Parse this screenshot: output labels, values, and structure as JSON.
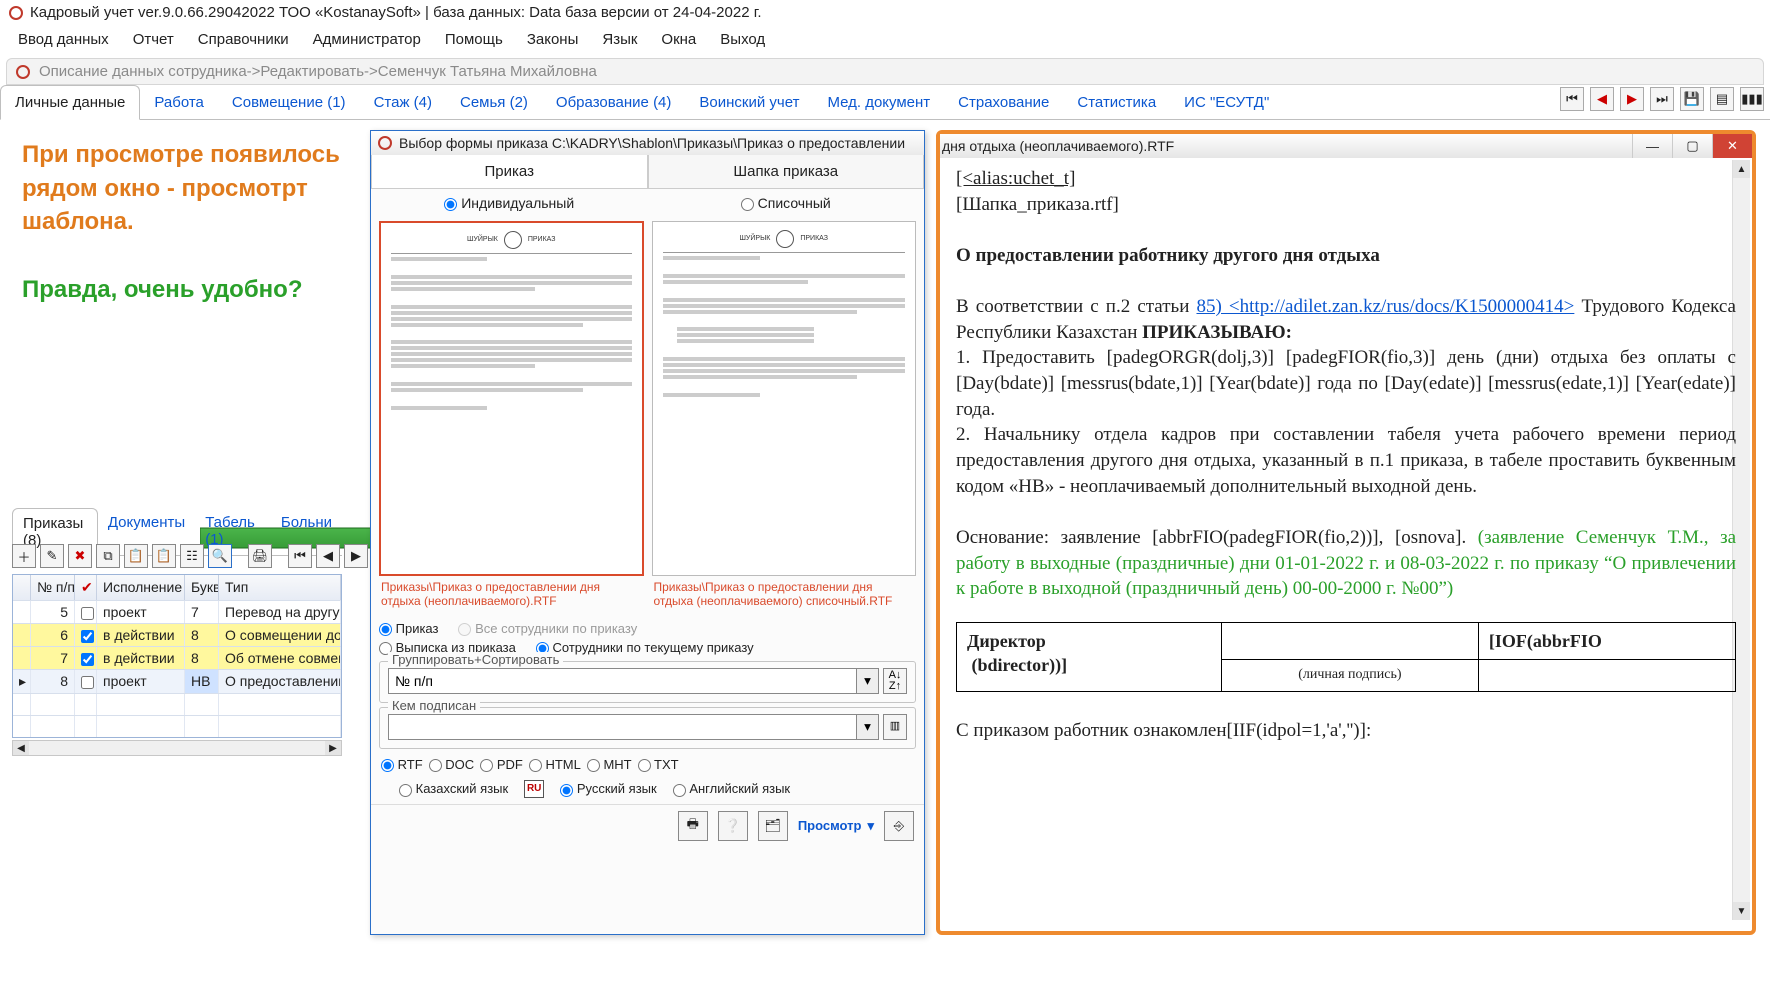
{
  "app": {
    "title": "Кадровый учет ver.9.0.66.29042022 ТОО «KostanaySoft» | база данных: Data база версии от 24-04-2022 г."
  },
  "menu": [
    "Ввод данных",
    "Отчет",
    "Справочники",
    "Администратор",
    "Помощь",
    "Законы",
    "Язык",
    "Окна",
    "Выход"
  ],
  "breadcrumb": "Описание данных сотрудника->Редактировать->Семенчук Татьяна Михайловна",
  "tabs": [
    "Личные данные",
    "Работа",
    "Совмещение (1)",
    "Стаж (4)",
    "Семья (2)",
    "Образование (4)",
    "Воинский учет",
    "Мед. документ",
    "Страхование",
    "Статистика",
    "ИС \"ЕСУТД\""
  ],
  "tabs_active_index": 0,
  "annotation": {
    "p1": "При просмотре появилось рядом окно - просмотрт шаблона.",
    "p2": "Правда, очень удобно?"
  },
  "subtabs": [
    "Приказы (8)",
    "Документы",
    "Табель (1)",
    "Больни"
  ],
  "grid": {
    "columns": [
      "№ п/п",
      "✔",
      "Исполнение",
      "Букв",
      "Тип"
    ],
    "rows": [
      {
        "n": 5,
        "chk": false,
        "isp": "проект",
        "bukv": "7",
        "tip": "Перевод на другую д",
        "hl": false
      },
      {
        "n": 6,
        "chk": true,
        "isp": "в действии",
        "bukv": "8",
        "tip": "О совмещении долж",
        "hl": true
      },
      {
        "n": 7,
        "chk": true,
        "isp": "в действии",
        "bukv": "8",
        "tip": "Об отмене совмещен",
        "hl": true
      },
      {
        "n": 8,
        "chk": false,
        "isp": "проект",
        "bukv": "НВ",
        "tip": "О предоставлении д",
        "hl": false,
        "current": true
      }
    ]
  },
  "dialog": {
    "title": "Выбор формы приказа C:\\KADRY\\Shablon\\Приказы\\Приказ о предоставлении",
    "tabs": [
      "Приказ",
      "Шапка приказа"
    ],
    "type_radios": [
      "Индивидуальный",
      "Списочный"
    ],
    "type_selected": 0,
    "captions": [
      "Приказы\\Приказ о предоставлении дня отдыха (неоплачиваемого).RTF",
      "Приказы\\Приказ о предоставлении дня отдыха (неоплачиваемого) списочный.RTF"
    ],
    "out_radios": {
      "prikaz": "Приказ",
      "vypiska": "Выписка из приказа"
    },
    "scope_radios": {
      "all": "Все сотрудники по приказу",
      "current": "Сотрудники по текущему приказу"
    },
    "group_legend": "Группировать+Сортировать",
    "group_value": "№ п/п",
    "signed_legend": "Кем подписан",
    "signed_value": "",
    "formats": [
      "RTF",
      "DOC",
      "PDF",
      "HTML",
      "MHT",
      "TXT"
    ],
    "format_selected": "RTF",
    "langs": [
      "Казахский язык",
      "Русский язык",
      "Английский язык"
    ],
    "lang_selected": 1,
    "preview_label": "Просмотр"
  },
  "preview": {
    "title_tail": "дня отдыха (неоплачиваемого).RTF",
    "line1": "[<alias:uchet_t]",
    "line2": "[Шапка_приказа.rtf]",
    "heading": "О  предоставлении работнику другого дня отдыха",
    "para1_before": "В соответствии с п.2 статьи ",
    "para1_link": "85) <http://adilet.zan.kz/rus/docs/K1500000414>",
    "para1_after": " Трудового Кодекса Республики Казахстан ",
    "prikazyvayu": "ПРИКАЗЫВАЮ:",
    "item1": "1.  Предоставить [padegORGR(dolj,3)] [padegFIOR(fio,3)] день (дни) отдыха без оплаты с [Day(bdate)] [messrus(bdate,1)] [Year(bdate)] года по [Day(edate)] [messrus(edate,1)] [Year(edate)] года.",
    "item2": "2.  Начальнику отдела кадров при составлении табеля учета рабочего времени период предоставления другого дня отдыха, указанный в п.1 приказа, в табеле проставить буквенным кодом «НВ» - неоплачиваемый дополнительный выходной день.",
    "osnov": "Основание: заявление [abbrFIO(padegFIOR(fio,2))], [osnova]. ",
    "osnov_green": "(заявление Семенчук Т.М., за работу в выходные (праздничные) дни 01-01-2022 г. и 08-03-2022 г. по приказу “О привлечении к работе в выходной (праздничный день) 00-00-2000 г. №00”)",
    "sig_left": "Директор",
    "sig_right": "[IOF(abbrFIO",
    "sig_left2": "(bdirector))]",
    "sig_note": "(личная подпись)",
    "ack": "С приказом работник ознакомлен[IIF(idpol=1,'а','')]:"
  }
}
